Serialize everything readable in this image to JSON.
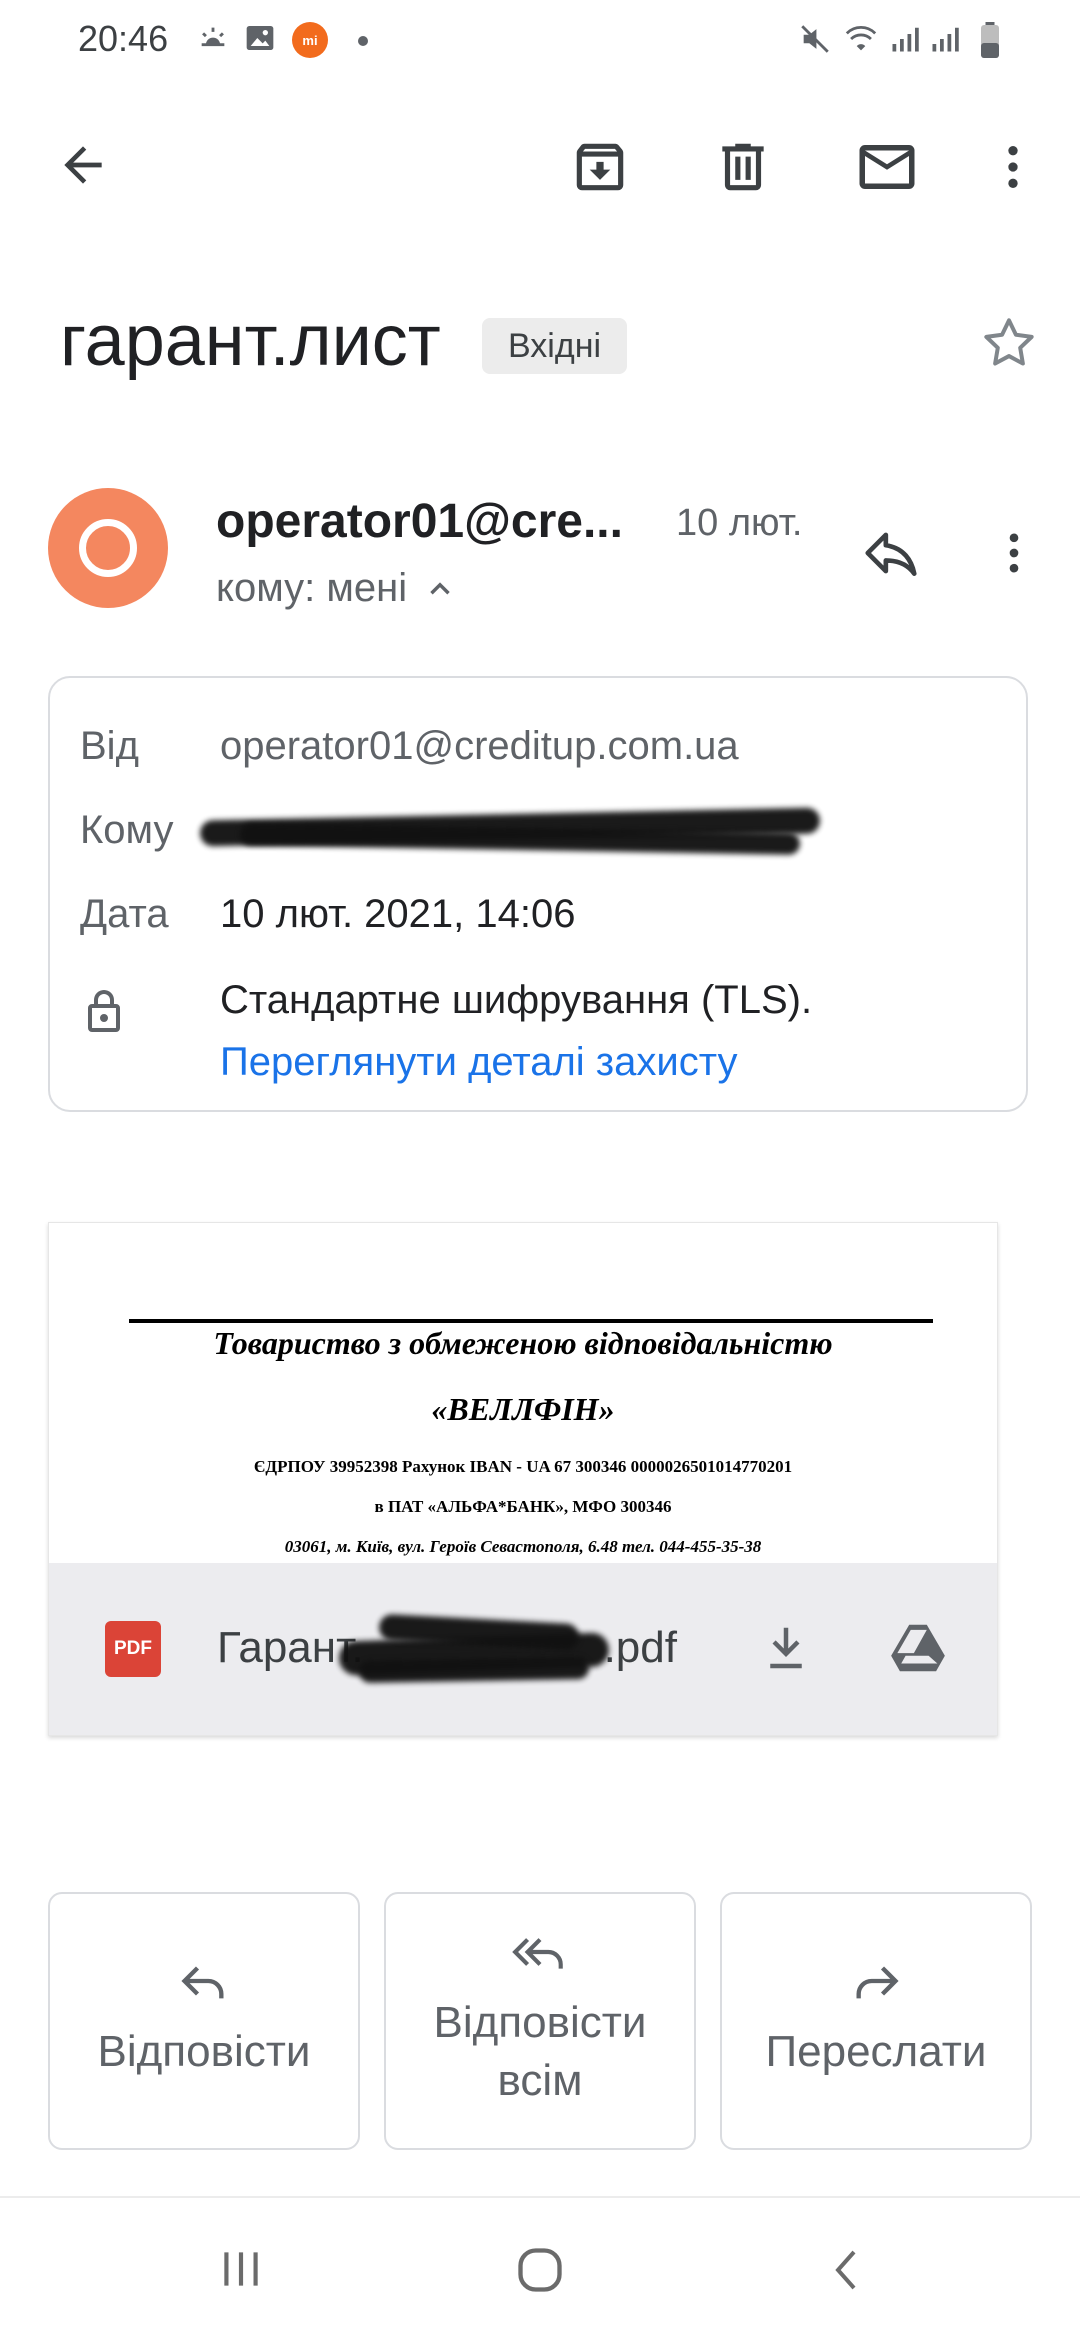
{
  "status_bar": {
    "time": "20:46",
    "left_icons": [
      "weather-icon",
      "image-icon",
      "mi-icon",
      "dot-icon"
    ],
    "right_icons": [
      "mute-icon",
      "wifi-icon",
      "signal-icon",
      "signal-icon",
      "battery-icon"
    ]
  },
  "toolbar": {
    "back_icon": "arrow-left-icon",
    "actions": [
      "archive-icon",
      "delete-icon",
      "mark-unread-icon",
      "more-vert-icon"
    ]
  },
  "email": {
    "subject": "гарант.лист",
    "label": "Вхідні",
    "sender_display": "operator01@cre...",
    "date_short": "10 лют.",
    "recipient_line": "кому: мені",
    "avatar_color": "#f4875f"
  },
  "details": {
    "from_label": "Від",
    "from_value": "operator01@creditup.com.ua",
    "to_label": "Кому",
    "date_label": "Дата",
    "date_value": "10 лют. 2021, 14:06",
    "encryption_text": "Стандартне шифрування (TLS).",
    "security_link": "Переглянути деталі захисту"
  },
  "attachment": {
    "preview_lines": [
      "Товариство з обмеженою відповідальністю",
      "«ВЕЛЛФІН»",
      "ЄДРПОУ 39952398 Рахунок IBAN - UA 67 300346 0000026501014770201",
      "в ПАТ «АЛЬФА*БАНК», МФО 300346",
      "03061, м. Київ, вул. Героїв Севастополя, 6.48 тел. 044-455-35-38"
    ],
    "badge": "PDF",
    "name_prefix": "Гарант.",
    "name_suffix": ".pdf"
  },
  "actions": {
    "reply": "Відповісти",
    "reply_all_1": "Відповісти",
    "reply_all_2": "всім",
    "forward": "Переслати"
  },
  "colors": {
    "link": "#1a73e8",
    "pdf_red": "#db4437",
    "text_primary": "#202124",
    "text_secondary": "#5f6368"
  }
}
